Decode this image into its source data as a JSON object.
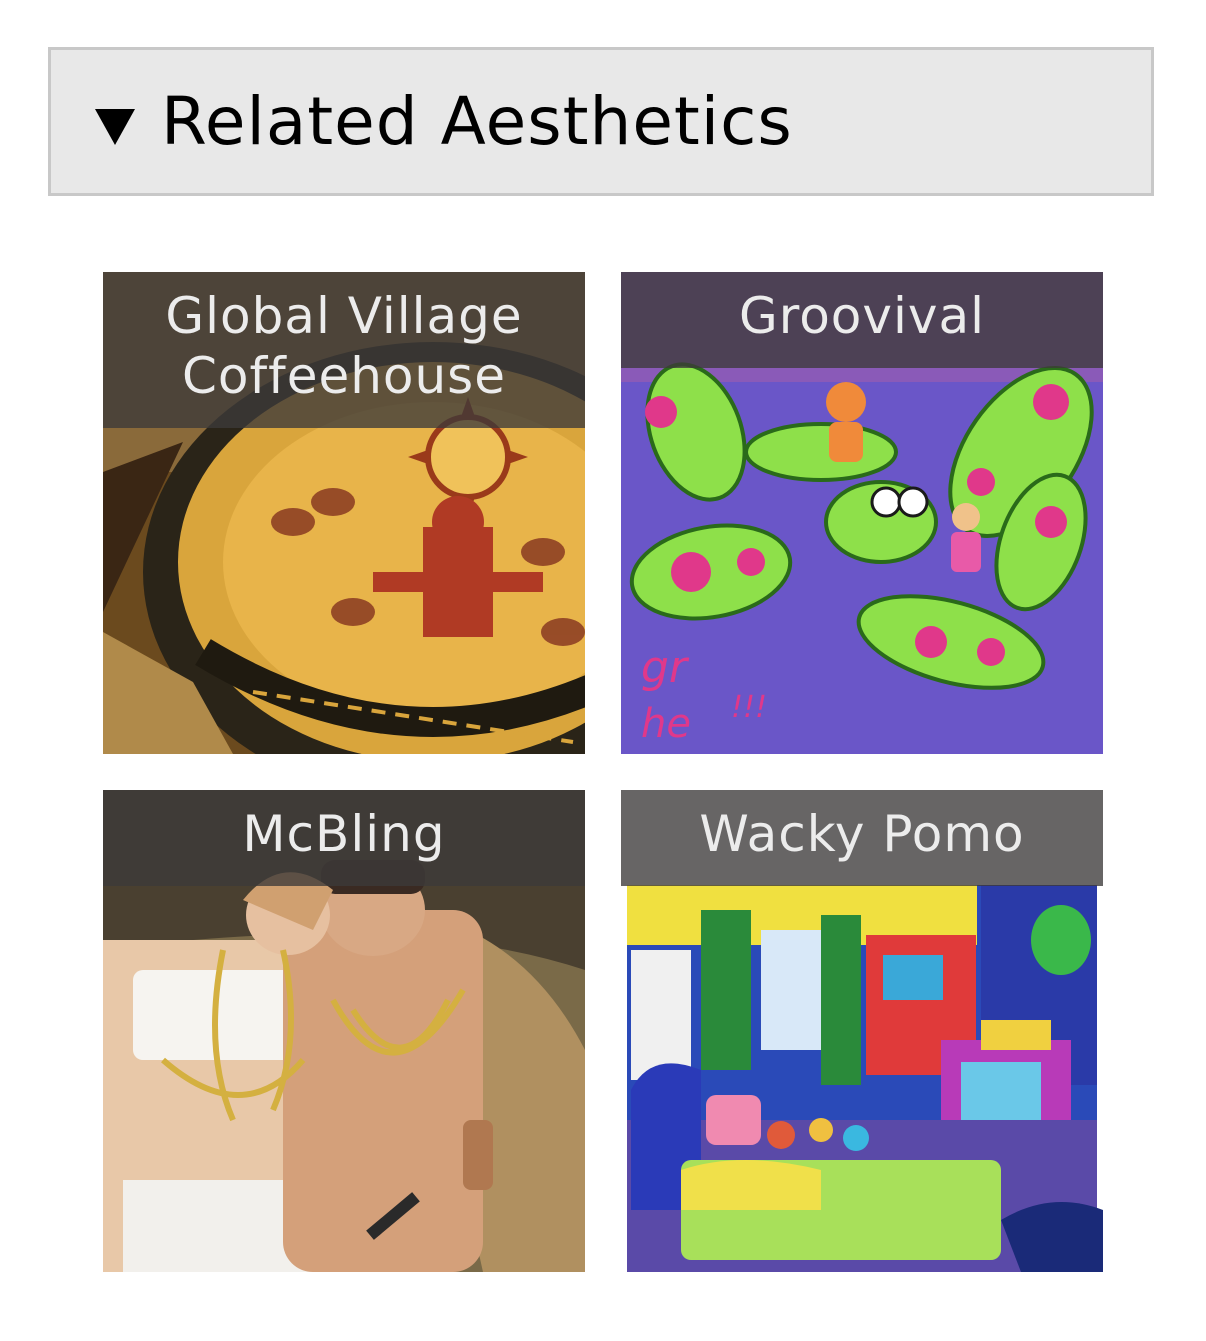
{
  "section": {
    "title": "Related Aesthetics",
    "toggle_icon": "triangle-down-icon",
    "expanded": true
  },
  "cards": [
    {
      "label": "Global Village Coffeehouse",
      "image": "mosaic-table-photo"
    },
    {
      "label": "Groovival",
      "image": "psychedelic-album-art"
    },
    {
      "label": "McBling",
      "image": "couple-gold-chains-photo"
    },
    {
      "label": "Wacky Pomo",
      "image": "colorful-kids-bedroom-photo"
    }
  ],
  "colors": {
    "header_bg": "#e8e8e8",
    "header_border": "#c8c8c8",
    "label_overlay": "#3c3a3a",
    "label_text": "#ececec"
  }
}
